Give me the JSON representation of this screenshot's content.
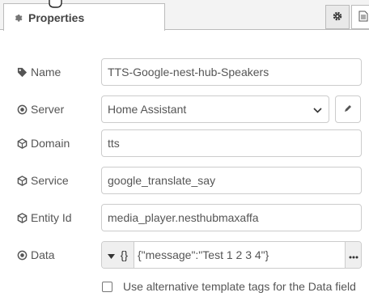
{
  "tab": {
    "label": "Properties",
    "icon": "gear-icon"
  },
  "toolbar": {
    "settings_icon": "gear-icon",
    "doc_icon": "document-icon"
  },
  "fields": {
    "name": {
      "label": "Name",
      "icon": "tag-icon",
      "value": "TTS-Google-nest-hub-Speakers"
    },
    "server": {
      "label": "Server",
      "icon": "server-dot-icon",
      "value": "Home Assistant",
      "edit_icon": "pencil-icon"
    },
    "domain": {
      "label": "Domain",
      "icon": "cube-icon",
      "value": "tts"
    },
    "service": {
      "label": "Service",
      "icon": "cube-icon",
      "value": "google_translate_say"
    },
    "entity_id": {
      "label": "Entity Id",
      "icon": "cube-icon",
      "value": "media_player.nesthubmaxaffa"
    },
    "data": {
      "label": "Data",
      "icon": "server-dot-icon",
      "type_symbol": "{}",
      "value": "{\"message\":\"Test 1 2 3 4\"}"
    }
  },
  "alt_template": {
    "label": "Use alternative template tags for the Data field",
    "checked": false
  }
}
